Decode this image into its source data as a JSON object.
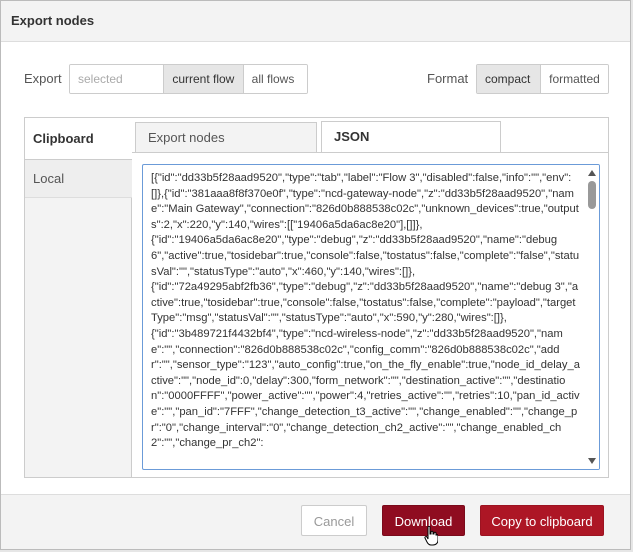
{
  "dialog": {
    "title": "Export nodes"
  },
  "export": {
    "label": "Export",
    "options": [
      "selected nodes",
      "current flow",
      "all flows"
    ],
    "selected": "current flow"
  },
  "format": {
    "label": "Format",
    "options": [
      "compact",
      "formatted"
    ],
    "selected": "compact"
  },
  "sidebar": {
    "items": [
      {
        "label": "Clipboard"
      },
      {
        "label": "Local"
      }
    ]
  },
  "tabs": [
    {
      "label": "Export nodes"
    },
    {
      "label": "JSON"
    }
  ],
  "json_text": "[{\"id\":\"dd33b5f28aad9520\",\"type\":\"tab\",\"label\":\"Flow 3\",\"disabled\":false,\"info\":\"\",\"env\":[]},{\"id\":\"381aaa8f8f370e0f\",\"type\":\"ncd-gateway-node\",\"z\":\"dd33b5f28aad9520\",\"name\":\"Main Gateway\",\"connection\":\"826d0b888538c02c\",\"unknown_devices\":true,\"outputs\":2,\"x\":220,\"y\":140,\"wires\":[[\"19406a5da6ac8e20\"],[]]},\n{\"id\":\"19406a5da6ac8e20\",\"type\":\"debug\",\"z\":\"dd33b5f28aad9520\",\"name\":\"debug 6\",\"active\":true,\"tosidebar\":true,\"console\":false,\"tostatus\":false,\"complete\":\"false\",\"statusVal\":\"\",\"statusType\":\"auto\",\"x\":460,\"y\":140,\"wires\":[]},\n{\"id\":\"72a49295abf2fb36\",\"type\":\"debug\",\"z\":\"dd33b5f28aad9520\",\"name\":\"debug 3\",\"active\":true,\"tosidebar\":true,\"console\":false,\"tostatus\":false,\"complete\":\"payload\",\"targetType\":\"msg\",\"statusVal\":\"\",\"statusType\":\"auto\",\"x\":590,\"y\":280,\"wires\":[]},\n{\"id\":\"3b489721f4432bf4\",\"type\":\"ncd-wireless-node\",\"z\":\"dd33b5f28aad9520\",\"name\":\"\",\"connection\":\"826d0b888538c02c\",\"config_comm\":\"826d0b888538c02c\",\"addr\":\"\",\"sensor_type\":\"123\",\"auto_config\":true,\"on_the_fly_enable\":true,\"node_id_delay_active\":\"\",\"node_id\":0,\"delay\":300,\"form_network\":\"\",\"destination_active\":\"\",\"destination\":\"0000FFFF\",\"power_active\":\"\",\"power\":4,\"retries_active\":\"\",\"retries\":10,\"pan_id_active\":\"\",\"pan_id\":\"7FFF\",\"change_detection_t3_active\":\"\",\"change_enabled\":\"\",\"change_pr\":\"0\",\"change_interval\":\"0\",\"change_detection_ch2_active\":\"\",\"change_enabled_ch2\":\"\",\"change_pr_ch2\":",
  "buttons": {
    "cancel": "Cancel",
    "download": "Download",
    "copy": "Copy to clipboard"
  },
  "colors": {
    "primary": "#ad1625",
    "primary_pressed": "#8f0c20",
    "focus_border": "#6b9bd8"
  }
}
